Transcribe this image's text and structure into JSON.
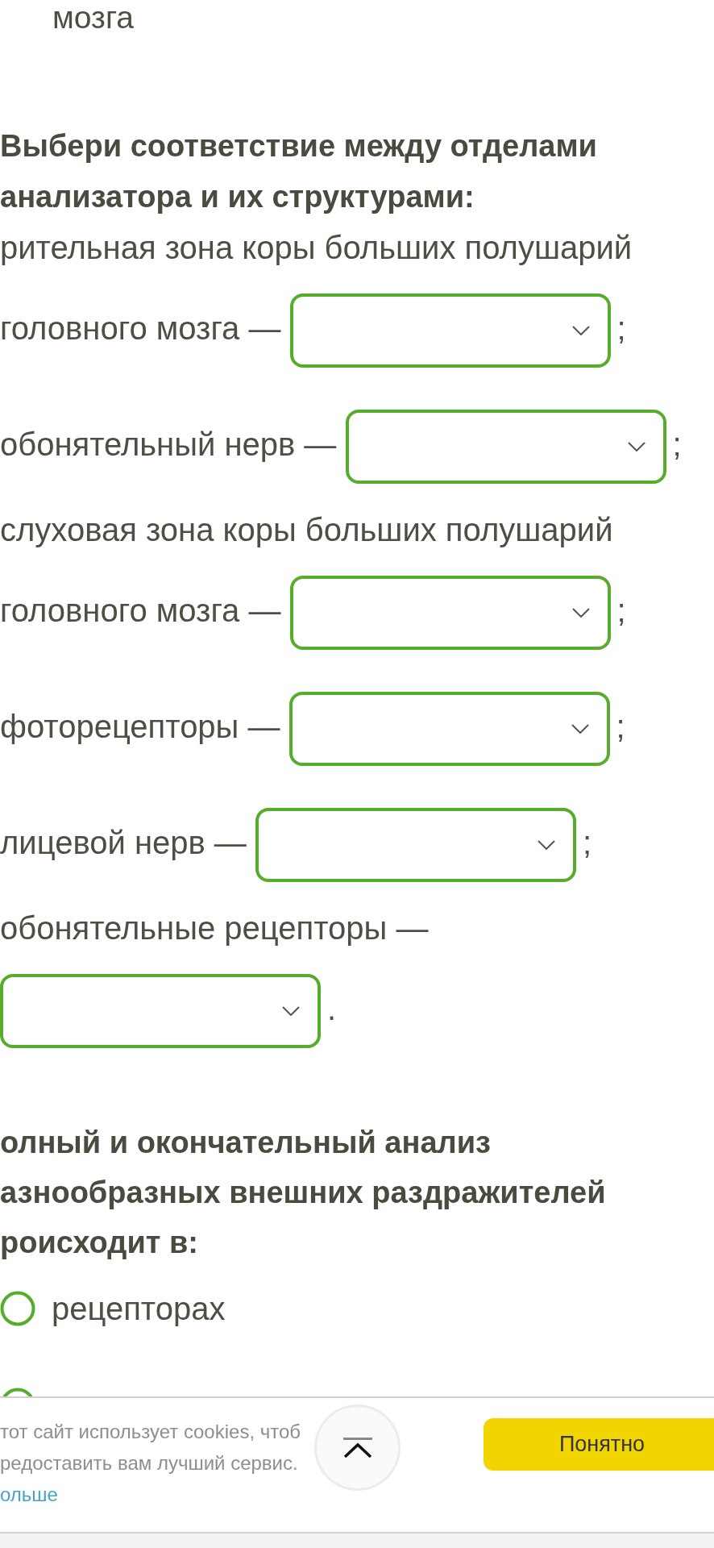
{
  "previous_question": {
    "option_tail": "мозга"
  },
  "matching_question": {
    "title_lines": [
      "Выбери соответствие между отделами",
      "анализатора и их структурами:"
    ],
    "items": [
      {
        "lines": [
          "рительная зона коры больших полушарий",
          "головного мозга —"
        ],
        "punct": ";"
      },
      {
        "lines": [
          "обонятельный нерв —"
        ],
        "punct": ";"
      },
      {
        "lines": [
          "слуховая зона коры больших полушарий",
          "головного мозга —"
        ],
        "punct": ";"
      },
      {
        "lines": [
          "фоторецепторы —"
        ],
        "punct": ";"
      },
      {
        "lines": [
          "лицевой нерв —"
        ],
        "punct": ";"
      },
      {
        "lines": [
          "обонятельные рецепторы —"
        ],
        "punct": "."
      }
    ]
  },
  "choice_question": {
    "title_lines": [
      "олный и окончательный анализ",
      "азнообразных внешних раздражителей",
      "роисходит в:"
    ],
    "options": [
      {
        "label": "рецепторах",
        "selected": false
      },
      {
        "selected": false
      }
    ]
  },
  "cookie_banner": {
    "text_lines": [
      "тот сайт использует cookies, чтоб",
      "редоставить вам лучший сервис."
    ],
    "link": "ольше",
    "accept_button": "Понятно"
  }
}
